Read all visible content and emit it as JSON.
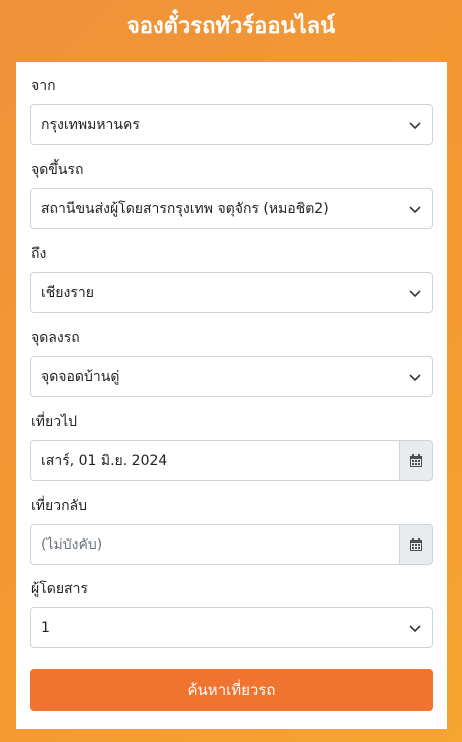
{
  "header": {
    "title": "จองตั๋วรถทัวร์ออนไลน์"
  },
  "form": {
    "from": {
      "label": "จาก",
      "value": "กรุงเทพมหานคร"
    },
    "boarding": {
      "label": "จุดขึ้นรถ",
      "value": "สถานีขนส่งผู้โดยสารกรุงเทพ จตุจักร (หมอชิต2)"
    },
    "to": {
      "label": "ถึง",
      "value": "เชียงราย"
    },
    "dropoff": {
      "label": "จุดลงรถ",
      "value": "จุดจอดบ้านดู่"
    },
    "depart": {
      "label": "เที่ยวไป",
      "value": "เสาร์, 01 มิ.ย. 2024"
    },
    "return": {
      "label": "เที่ยวกลับ",
      "placeholder": "(ไม่บังคับ)"
    },
    "passengers": {
      "label": "ผู้โดยสาร",
      "value": "1"
    },
    "search_label": "ค้นหาเที่ยวรถ"
  },
  "icons": {
    "select_arrow": "chevron-down-icon",
    "date_picker": "calendar-icon"
  },
  "colors": {
    "background": "#f49b32",
    "button": "#ee742f",
    "input_border": "#cfd4da",
    "addon_bg": "#e9ecef"
  }
}
